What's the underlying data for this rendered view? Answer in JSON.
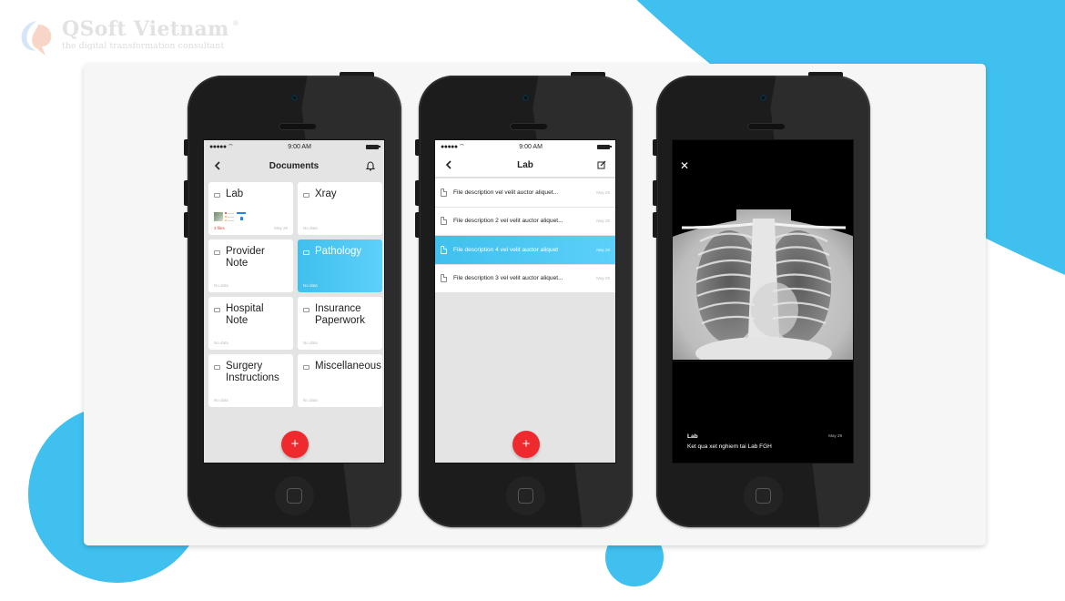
{
  "brand": {
    "name": "QSoft Vietnam",
    "registered": "®",
    "tagline": "the digital transformation consultant",
    "accent_color": "#3fc0ee"
  },
  "status_bar": {
    "signal": "●●●●●",
    "time": "9:00 AM"
  },
  "documents_screen": {
    "title": "Documents",
    "back_icon": "chevron-left-icon",
    "bell_icon": "bell-icon",
    "folders": [
      {
        "name": "Lab",
        "meta": "3 files",
        "date": "May 29",
        "has_thumbs": true,
        "active": false
      },
      {
        "name": "Xray",
        "meta": "No data",
        "date": "",
        "active": false
      },
      {
        "name": "Provider Note",
        "meta": "No data",
        "date": "",
        "active": false
      },
      {
        "name": "Pathology",
        "meta": "No data",
        "date": "",
        "active": true
      },
      {
        "name": "Hospital Note",
        "meta": "No data",
        "date": "",
        "active": false
      },
      {
        "name": "Insurance Paperwork",
        "meta": "No data",
        "date": "",
        "active": false
      },
      {
        "name": "Surgery Instructions",
        "meta": "No data",
        "date": "",
        "active": false
      },
      {
        "name": "Miscellaneous",
        "meta": "No data",
        "date": "",
        "active": false
      }
    ],
    "fab_label": "+",
    "fab_color": "#ee2a2f"
  },
  "lab_screen": {
    "title": "Lab",
    "back_icon": "chevron-left-icon",
    "edit_icon": "edit-icon",
    "files": [
      {
        "label": "File description vel velit auctor aliquet...",
        "date": "May 29",
        "active": false
      },
      {
        "label": "File description 2 vel velit auctor aliquet...",
        "date": "May 25",
        "active": false
      },
      {
        "label": "File description 4 vel velit auctor aliquet",
        "date": "May 29",
        "active": true
      },
      {
        "label": "File description 3 vel velit auctor aliquet...",
        "date": "May 25",
        "active": false
      }
    ],
    "fab_label": "+"
  },
  "viewer_screen": {
    "close_label": "✕",
    "image_alt": "Chest X-ray",
    "caption_title": "Lab",
    "caption_subtitle": "Ket qua xet nghiem tai Lab FGH",
    "caption_date": "May 29"
  }
}
